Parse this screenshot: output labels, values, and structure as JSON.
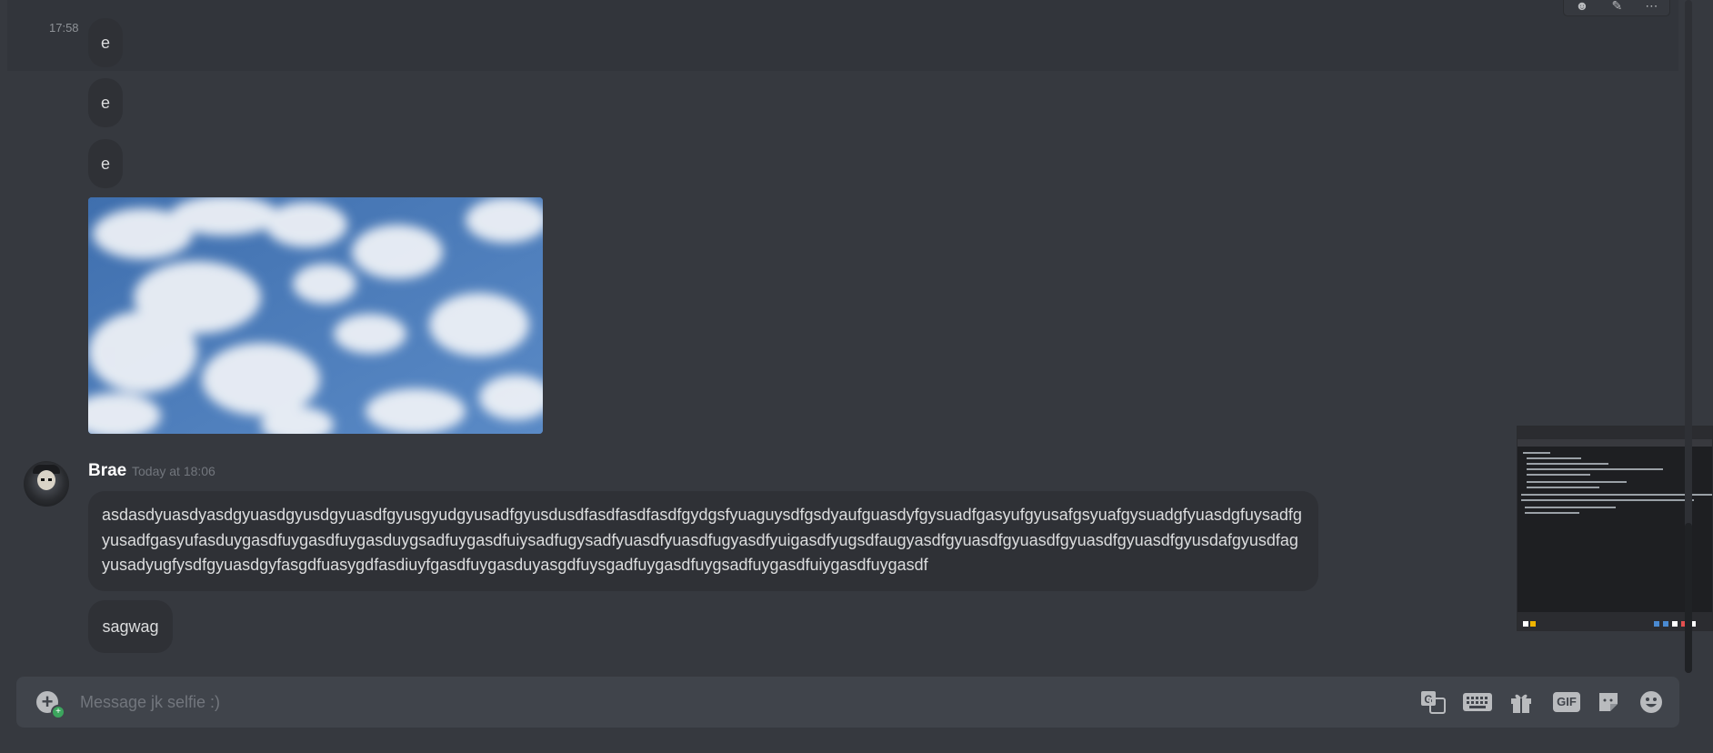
{
  "window": {
    "hovered_message_time": "17:58"
  },
  "messages": {
    "short_e": [
      "e",
      "e",
      "e"
    ],
    "image_attachment": "sky-clouds-image"
  },
  "author_group": {
    "username": "Brae",
    "timestamp": "Today at 18:06",
    "long_message": "asdasdyuasdyasdgyuasdgyusdgyuasdfgyusgyudgyusadfgyusdusdfasdfasdfasdfgydgsfyuaguysdfgsdyaufguasdyfgysuadfgasyufgyusafgsyuafgysuadgfyuasdgfuysadfgyusadfgasyufasduygasdfuygasdfuygasduygsadfuygasdfuiysadfugysadfyuasdfyuasdfugyasdfyuigasdfyugsdfaugyasdfgyuasdfgyuasdfgyuasdfgyuasdfgyusdafgyusdfagyusadyugfysdfgyuasdgyfasgdfuasygdfasdiuyfgasdfuygasduyasgdfuysgadfuygasdfuygsadfuygasdfuiygasdfuygasdf",
    "short_message": "sagwag"
  },
  "composer": {
    "placeholder": "Message jk selfie :)",
    "gif_label": "GIF"
  },
  "icons": {
    "message_toolbar": [
      "reaction-icon",
      "edit-icon",
      "more-icon"
    ],
    "composer_tools": [
      "translate-icon",
      "keyboard-icon",
      "gift-icon",
      "gif-icon",
      "sticker-icon",
      "emoji-icon"
    ]
  },
  "colors": {
    "background": "#36393f",
    "bubble": "#2f3136",
    "composer": "#40444b",
    "online_badge": "#3ba55d"
  }
}
